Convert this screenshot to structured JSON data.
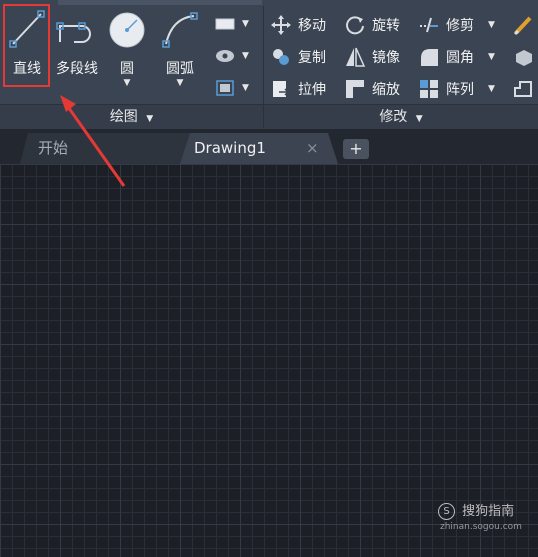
{
  "draw_panel": {
    "line_label": "直线",
    "polyline_label": "多段线",
    "circle_label": "圆",
    "arc_label": "圆弧",
    "footer_label": "绘图"
  },
  "modify_panel": {
    "move_label": "移动",
    "rotate_label": "旋转",
    "trim_label": "修剪",
    "copy_label": "复制",
    "mirror_label": "镜像",
    "fillet_label": "圆角",
    "stretch_label": "拉伸",
    "scale_label": "缩放",
    "array_label": "阵列",
    "footer_label": "修改"
  },
  "tabs": {
    "start_label": "开始",
    "drawing_label": "Drawing1",
    "close_glyph": "×",
    "add_glyph": "+"
  },
  "watermark": {
    "brand": "搜狗指南",
    "site": "zhinan.sogou.com"
  },
  "colors": {
    "ribbon_bg": "#3b4452",
    "canvas_bg": "#1c1f26",
    "highlight": "#e53935",
    "annotation_arrow": "#e53935"
  }
}
